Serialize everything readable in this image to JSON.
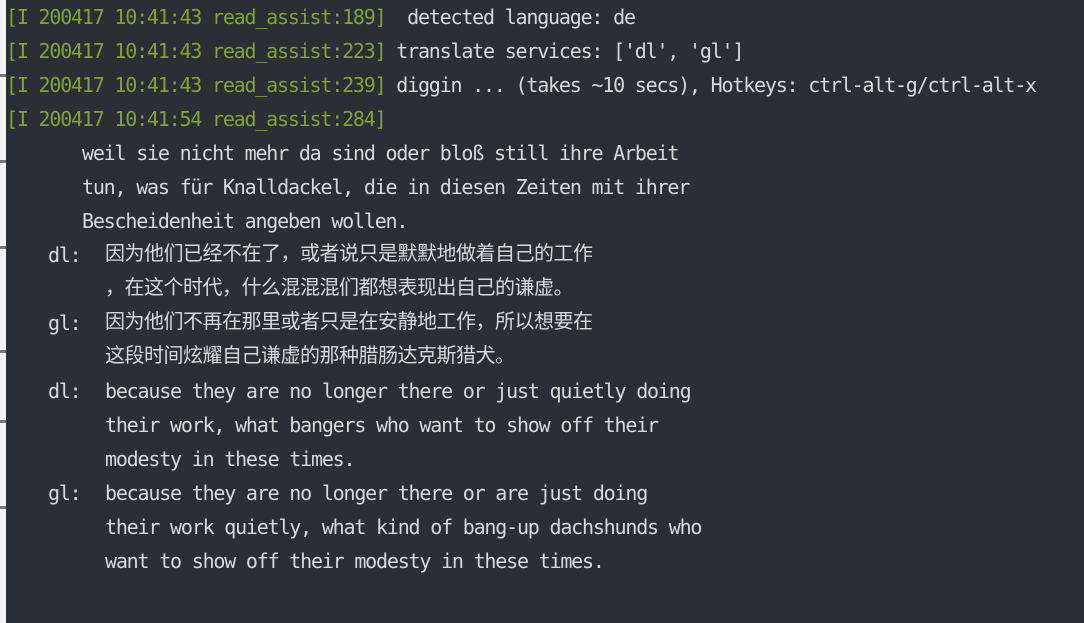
{
  "log": [
    {
      "prefix": "[I 200417 10:41:43 read_assist:189]",
      "message": "  detected language: de"
    },
    {
      "prefix": "[I 200417 10:41:43 read_assist:223]",
      "message": " translate services: ['dl', 'gl']"
    },
    {
      "prefix": "[I 200417 10:41:43 read_assist:239]",
      "message": " diggin ... (takes ~10 secs), Hotkeys: ctrl-alt-g/ctrl-alt-x"
    },
    {
      "prefix": "[I 200417 10:41:54 read_assist:284]",
      "message": ""
    }
  ],
  "source_text": [
    "weil sie nicht mehr da sind oder bloß still ihre Arbeit",
    "tun, was für Knalldackel, die in diesen Zeiten mit ihrer",
    "Bescheidenheit angeben wollen."
  ],
  "translations": [
    {
      "label": "dl:",
      "lines": [
        "因为他们已经不在了，或者说只是默默地做着自己的工作",
        "，在这个时代，什么混混混们都想表现出自己的谦虚。"
      ]
    },
    {
      "label": "gl:",
      "lines": [
        "因为他们不再在那里或者只是在安静地工作，所以想要在",
        "这段时间炫耀自己谦虚的那种腊肠达克斯猎犬。"
      ]
    },
    {
      "label": "dl:",
      "lines": [
        "because they are no longer there or just quietly doing",
        "their work, what bangers who want to show off their",
        "modesty in these times."
      ]
    },
    {
      "label": "gl:",
      "lines": [
        "because they are no longer there or are just doing",
        "their work quietly, what kind of bang-up dachshunds who",
        "want to show off their modesty in these times."
      ]
    }
  ],
  "colors": {
    "background": "#2b2e34",
    "prefix": "#7fa338",
    "text": "#d7d8da"
  }
}
